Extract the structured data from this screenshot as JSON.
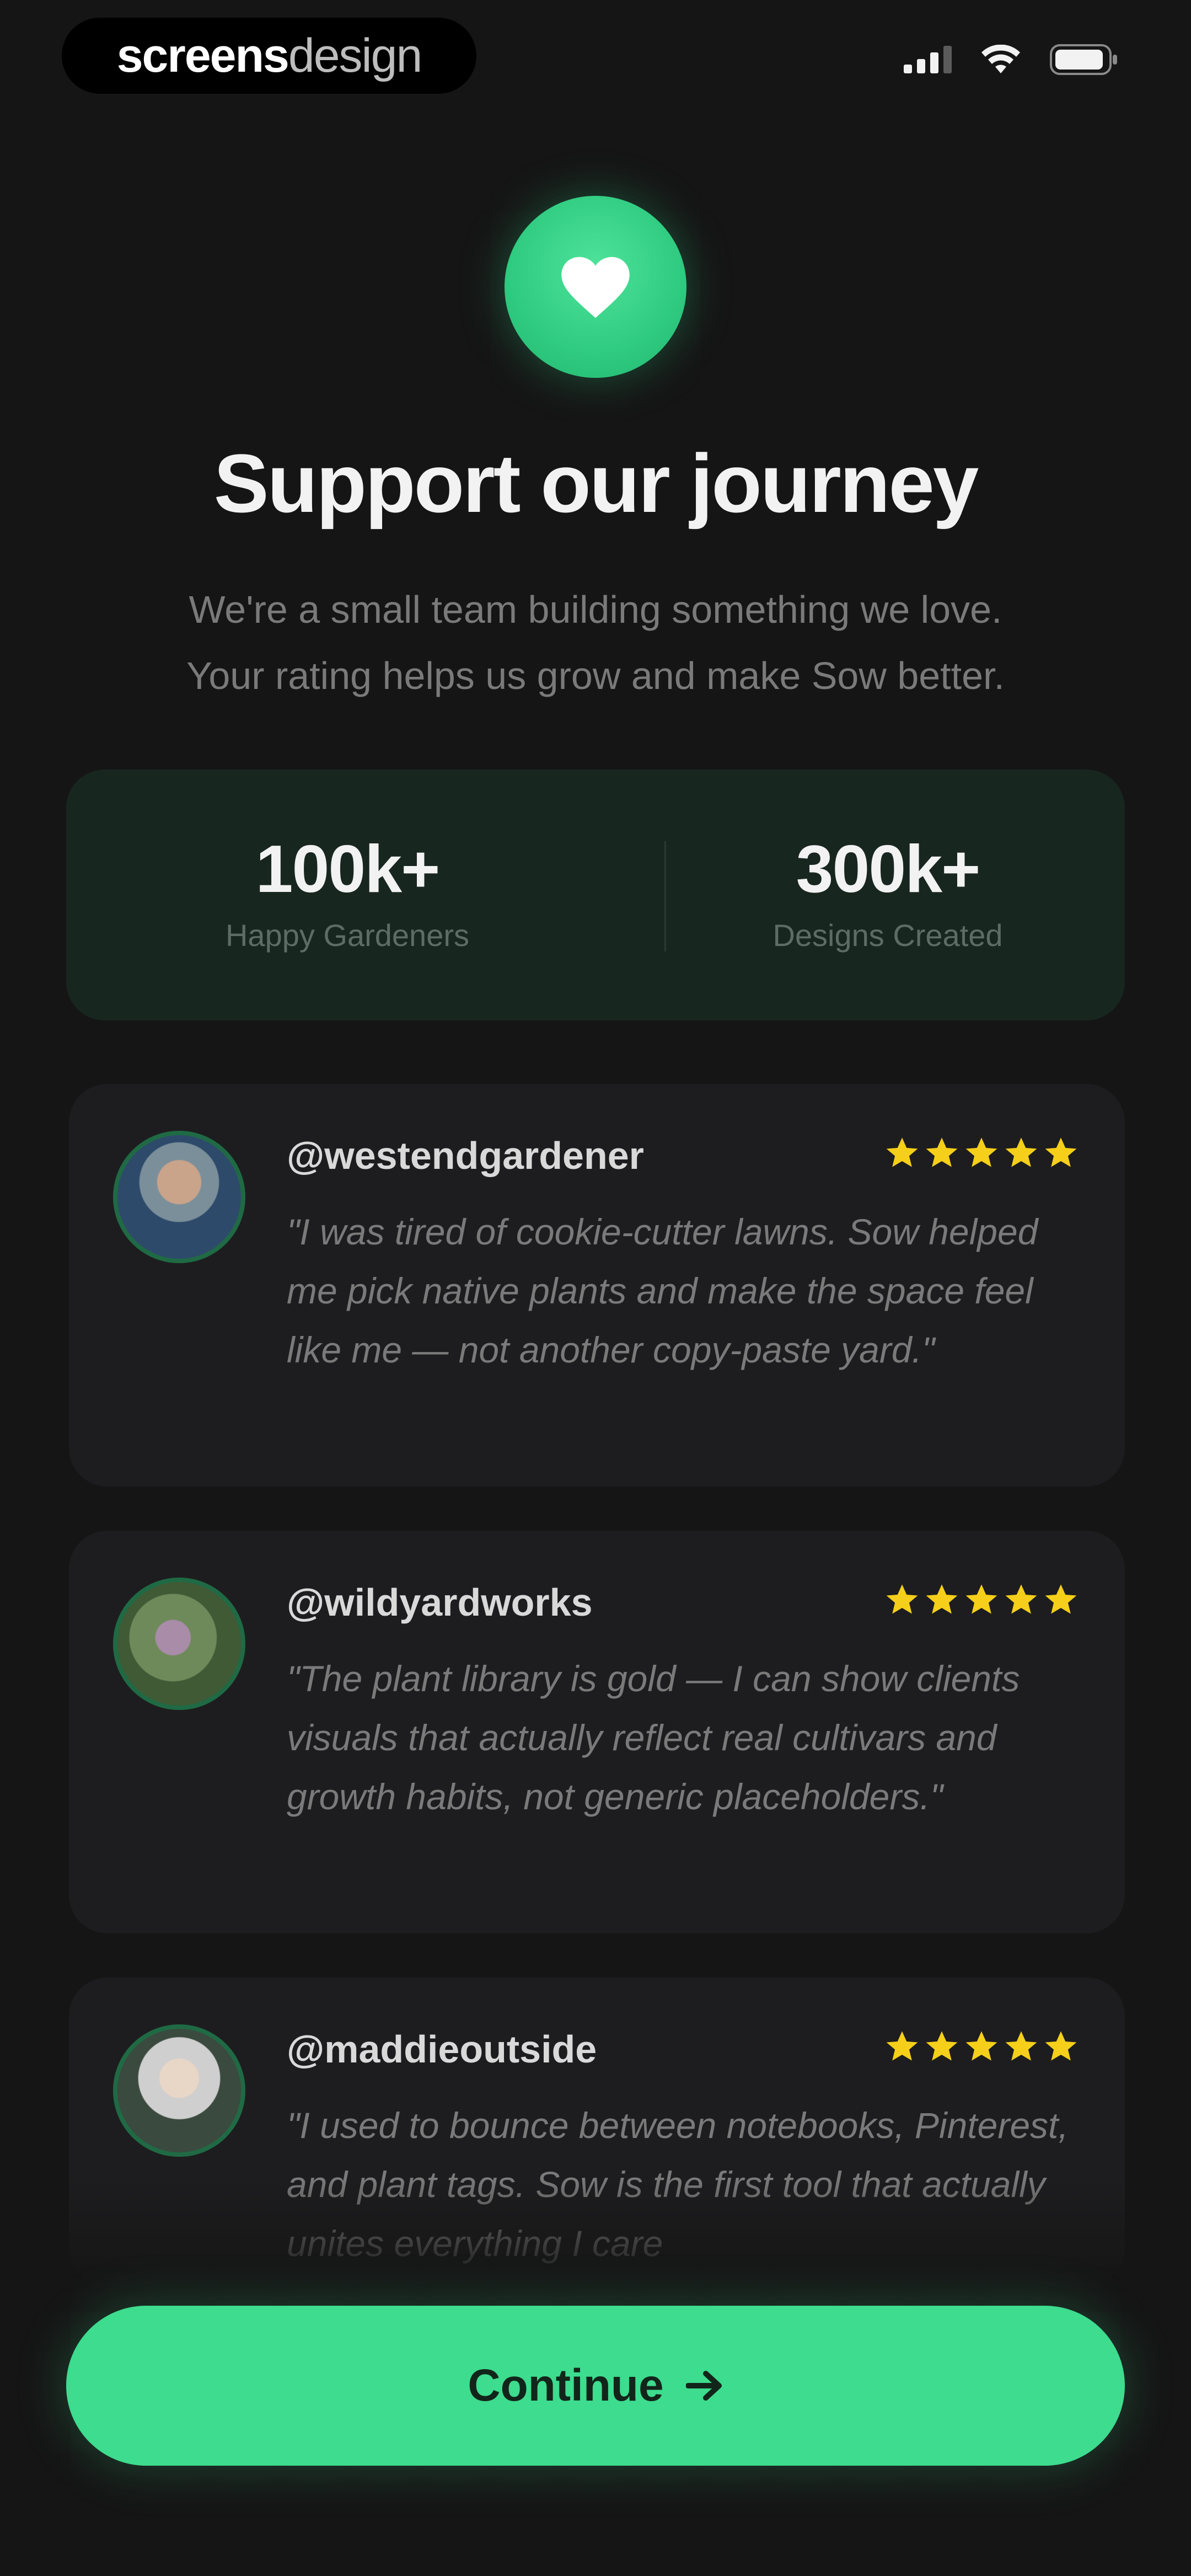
{
  "status_bar": {
    "brand_bold": "screens",
    "brand_light": "design"
  },
  "header": {
    "icon": "heart-icon",
    "title": "Support our journey",
    "subtitle_line1": "We're a small team building something we love.",
    "subtitle_line2": "Your rating helps us grow and make Sow better."
  },
  "stats": [
    {
      "value": "100k+",
      "label": "Happy Gardeners"
    },
    {
      "value": "300k+",
      "label": "Designs Created"
    }
  ],
  "testimonials": [
    {
      "handle": "@westendgardener",
      "rating": 5,
      "quote": "\"I was tired of cookie-cutter lawns. Sow helped me pick native plants and make the space feel like me — not another copy-paste yard.\""
    },
    {
      "handle": "@wildyardworks",
      "rating": 5,
      "quote": "\"The plant library is gold — I can show clients visuals that actually reflect real cultivars and growth habits, not generic placeholders.\""
    },
    {
      "handle": "@maddieoutside",
      "rating": 5,
      "quote": "\"I used to bounce between notebooks, Pinterest, and plant tags. Sow is the first tool that actually unites everything I care"
    }
  ],
  "cta": {
    "label": "Continue",
    "icon": "arrow-right-icon"
  },
  "colors": {
    "background": "#151515",
    "accent": "#3ddc8e",
    "stats_card": "#182620",
    "card": "#1d1d1f",
    "star": "#f5cf1a"
  }
}
